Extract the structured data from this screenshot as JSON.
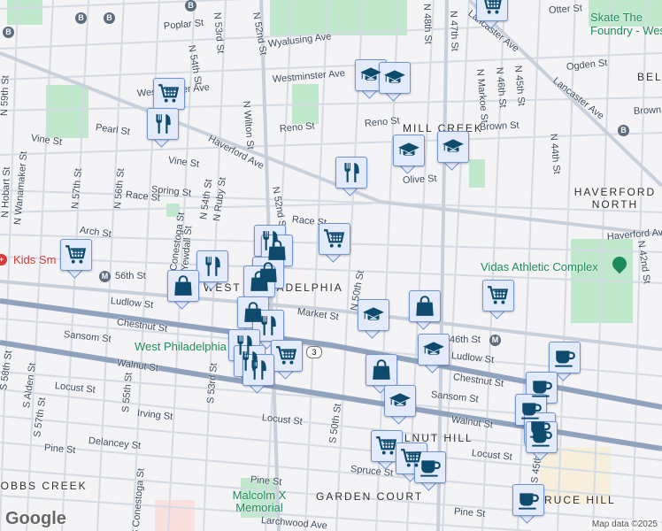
{
  "streets": [
    "Poplar St",
    "N 53rd St",
    "N 52nd St",
    "Wyalusing Ave",
    "Westminster Ave",
    "Westminster Ave",
    "N 54th St",
    "N Wilton St",
    "Reno St",
    "Reno St",
    "Pearl St",
    "Vine St",
    "Vine St",
    "Haverford Ave",
    "N 59th St",
    "N Hobart St",
    "N Wanamaker St",
    "N 57th St",
    "N 56th St",
    "Spring St",
    "Race St",
    "Race St",
    "Arch St",
    "Conestoga St",
    "Yewdall St",
    "N 54th St",
    "N Ruby St",
    "N 52nd St",
    "56th St",
    "Ludlow St",
    "Market St",
    "Chestnut St",
    "Chestnut St",
    "Sansom St",
    "Sansom St",
    "Walnut St",
    "Walnut St",
    "Locust St",
    "Locust St",
    "Locust St",
    "Irving St",
    "Delancey St",
    "Pine St",
    "Pine St",
    "Pine St",
    "S 58th St",
    "S Alden St",
    "S 57th St",
    "S 55th St",
    "S Conestoga St",
    "S 53rd St",
    "S 50th St",
    "S 45th St",
    "Larchwood Ave",
    "Spruce St",
    "N 50th St",
    "N 48th St",
    "N 47th St",
    "N Markoe St",
    "N 46th St",
    "N 45th St",
    "N 44th St",
    "Otter St",
    "Ogden St",
    "Lancaster Ave",
    "Lancaster Ave",
    "Brown St",
    "Brown St",
    "Olive St",
    "Haverford Ave",
    "N 42nd St",
    "46th St",
    "Ludlow St"
  ],
  "neighborhoods": [
    "MILL CREEK",
    "HAVERFORD NORTH",
    "BELMONT",
    "WEST PHILADELPHIA",
    "WALNUT HILL",
    "GARDEN COURT",
    "SPRUCE HILL",
    "COBBS CREEK"
  ],
  "pois": {
    "skate": "Skate The Foundry - West",
    "vidas": "Vidas Athletic Complex",
    "westphilly": "West Philadelphia",
    "malcolm": "Malcolm X Memorial",
    "kids": "Kids Sm"
  },
  "markers": [
    "cart",
    "restaurant",
    "cart",
    "restaurant",
    "shopping-bag",
    "restaurant",
    "shopping-bag",
    "shopping-bag",
    "shopping-bag",
    "shopping-bag",
    "restaurant",
    "restaurant",
    "restaurant",
    "cart",
    "restaurant",
    "cart",
    "restaurant",
    "school",
    "school",
    "school",
    "school",
    "cart",
    "school",
    "shopping-bag",
    "cart",
    "school",
    "shopping-bag",
    "school",
    "cart",
    "cart",
    "cafe",
    "cafe",
    "cafe",
    "cafe",
    "cafe",
    "cafe",
    "cafe"
  ],
  "transit": {
    "metro": "M",
    "bus": "B"
  },
  "route_shield": "3",
  "footer": {
    "logo": "Google",
    "attribution": "Map data ©2025"
  },
  "colors": {
    "marker_icon": "#0d4a6b",
    "marker_bg": "#e3ebfb",
    "park": "#bfe8cc",
    "major_road": "#8fa3bd"
  }
}
